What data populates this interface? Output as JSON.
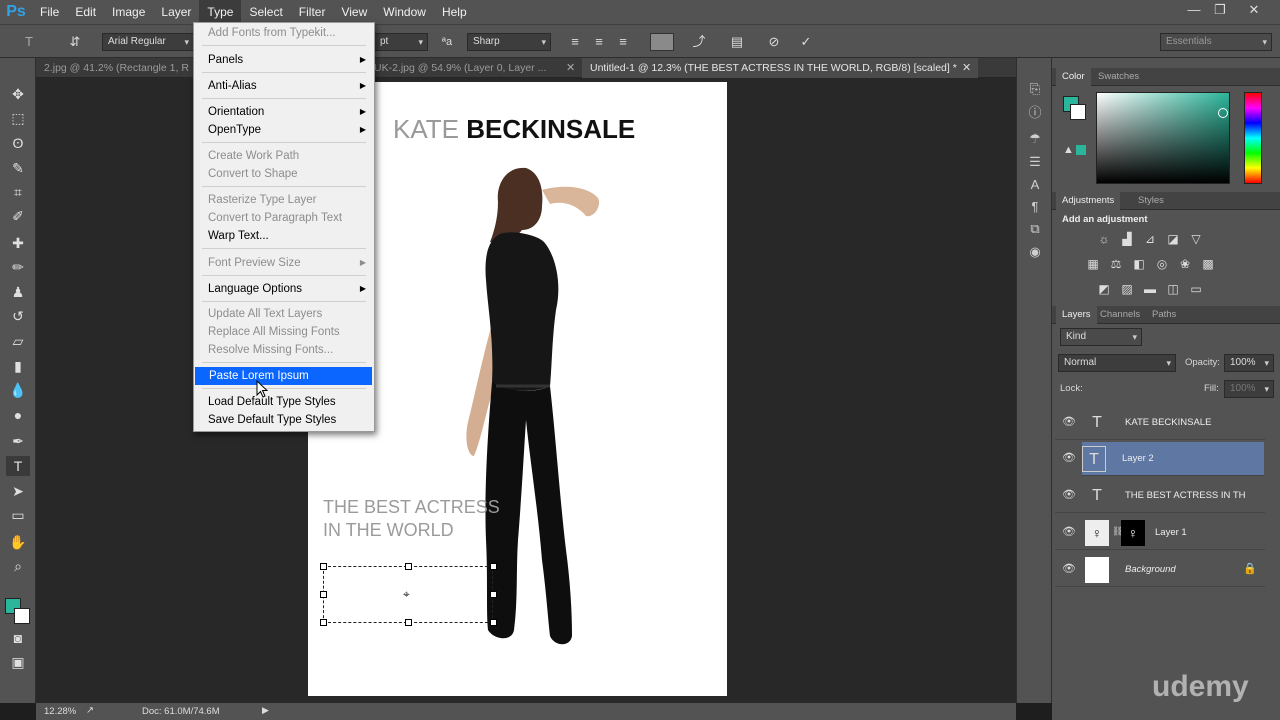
{
  "app": {
    "logo": "Ps"
  },
  "menubar": {
    "items": [
      "File",
      "Edit",
      "Image",
      "Layer",
      "Type",
      "Select",
      "Filter",
      "View",
      "Window",
      "Help"
    ]
  },
  "window_controls": {
    "minimize": "—",
    "restore": "❐",
    "close": "✕"
  },
  "options_bar": {
    "font_family": "Arial Regular",
    "size_unit": "pt",
    "antialias": "Sharp",
    "workspace": "Essentials"
  },
  "tabs": [
    {
      "label": "2.jpg @ 41.2% (Rectangle 1, R"
    },
    {
      "label": "UK-2.jpg @ 54.9% (Layer 0, Layer ..."
    },
    {
      "label": "Untitled-1 @ 12.3% (THE BEST ACTRESS  IN THE WORLD, RGB/8) [scaled] *"
    }
  ],
  "type_menu": {
    "items": [
      {
        "label": "Add Fonts from Typekit...",
        "disabled": true
      },
      {
        "label": "Panels",
        "submenu": true
      },
      {
        "label": "Anti-Alias",
        "submenu": true
      },
      {
        "label": "Orientation",
        "submenu": true
      },
      {
        "label": "OpenType",
        "submenu": true
      },
      {
        "label": "Create Work Path",
        "disabled": true
      },
      {
        "label": "Convert to Shape",
        "disabled": true
      },
      {
        "label": "Rasterize Type Layer",
        "disabled": true
      },
      {
        "label": "Convert to Paragraph Text",
        "disabled": true
      },
      {
        "label": "Warp Text..."
      },
      {
        "label": "Font Preview Size",
        "disabled": true,
        "submenu": true
      },
      {
        "label": "Language Options",
        "submenu": true
      },
      {
        "label": "Update All Text Layers",
        "disabled": true
      },
      {
        "label": "Replace All Missing Fonts",
        "disabled": true
      },
      {
        "label": "Resolve Missing Fonts...",
        "disabled": true
      },
      {
        "label": "Paste Lorem Ipsum",
        "highlighted": true
      },
      {
        "label": "Load Default Type Styles"
      },
      {
        "label": "Save Default Type Styles"
      }
    ]
  },
  "document": {
    "title_light": "KATE",
    "title_bold": "BECKINSALE",
    "subtitle_line1": "THE BEST ACTRESS",
    "subtitle_line2": "IN THE WORLD"
  },
  "status": {
    "zoom": "12.28%",
    "doc_size": "Doc: 61.0M/74.6M"
  },
  "color_panel": {
    "tabs": [
      "Color",
      "Swatches"
    ],
    "foreground": "#2bb59a"
  },
  "adjustments_panel": {
    "tabs": [
      "Adjustments",
      "Styles"
    ],
    "heading": "Add an adjustment"
  },
  "layers_panel": {
    "tabs": [
      "Layers",
      "Channels",
      "Paths"
    ],
    "filter_kind": "Kind",
    "blend_mode": "Normal",
    "opacity_label": "Opacity:",
    "opacity_value": "100%",
    "lock_label": "Lock:",
    "fill_label": "Fill:",
    "fill_value": "100%",
    "layers": [
      {
        "name": "KATE BECKINSALE",
        "type": "text"
      },
      {
        "name": "Layer 2",
        "type": "text",
        "selected": true
      },
      {
        "name": "THE BEST ACTRESS  IN TH...",
        "type": "text"
      },
      {
        "name": "Layer 1",
        "type": "image"
      },
      {
        "name": "Background",
        "type": "background",
        "locked": true
      }
    ]
  },
  "watermark": "udemy"
}
